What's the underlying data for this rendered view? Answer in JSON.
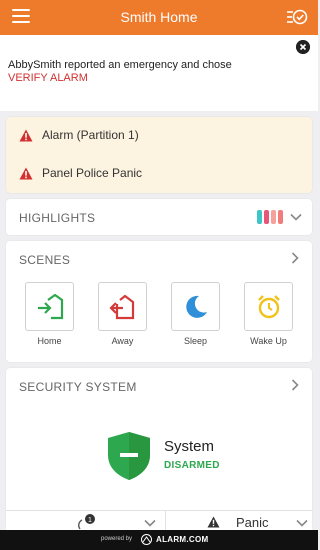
{
  "header": {
    "title": "Smith Home"
  },
  "alert": {
    "message": "AbbySmith reported an emergency and chose",
    "action_text": "VERIFY ALARM"
  },
  "warnings": [
    {
      "label": "Alarm (Partition 1)",
      "icon": "warning-icon"
    },
    {
      "label": "Panel Police Panic",
      "icon": "warning-icon"
    }
  ],
  "highlights": {
    "label": "HIGHLIGHTS",
    "bar_colors": [
      "#3ec4c9",
      "#e9557a",
      "#f5a39a",
      "#f07c7c"
    ]
  },
  "scenes": {
    "label": "SCENES",
    "items": [
      {
        "label": "Home",
        "icon": "home-enter-icon",
        "color": "#2ea84f"
      },
      {
        "label": "Away",
        "icon": "home-exit-icon",
        "color": "#d33b3b"
      },
      {
        "label": "Sleep",
        "icon": "moon-icon",
        "color": "#2f8fd8"
      },
      {
        "label": "Wake Up",
        "icon": "alarm-clock-icon",
        "color": "#f1c21b"
      }
    ]
  },
  "security": {
    "label": "SECURITY SYSTEM",
    "system_name": "System",
    "status": "DISARMED",
    "status_color": "#2ea84f"
  },
  "action_bar": {
    "badge_count": "1",
    "panic_label": "Panic"
  },
  "footer": {
    "powered_by": "powered by",
    "brand": "ALARM.COM"
  },
  "colors": {
    "brand_orange": "#ee7a2c",
    "alert_red": "#d32f2f"
  }
}
